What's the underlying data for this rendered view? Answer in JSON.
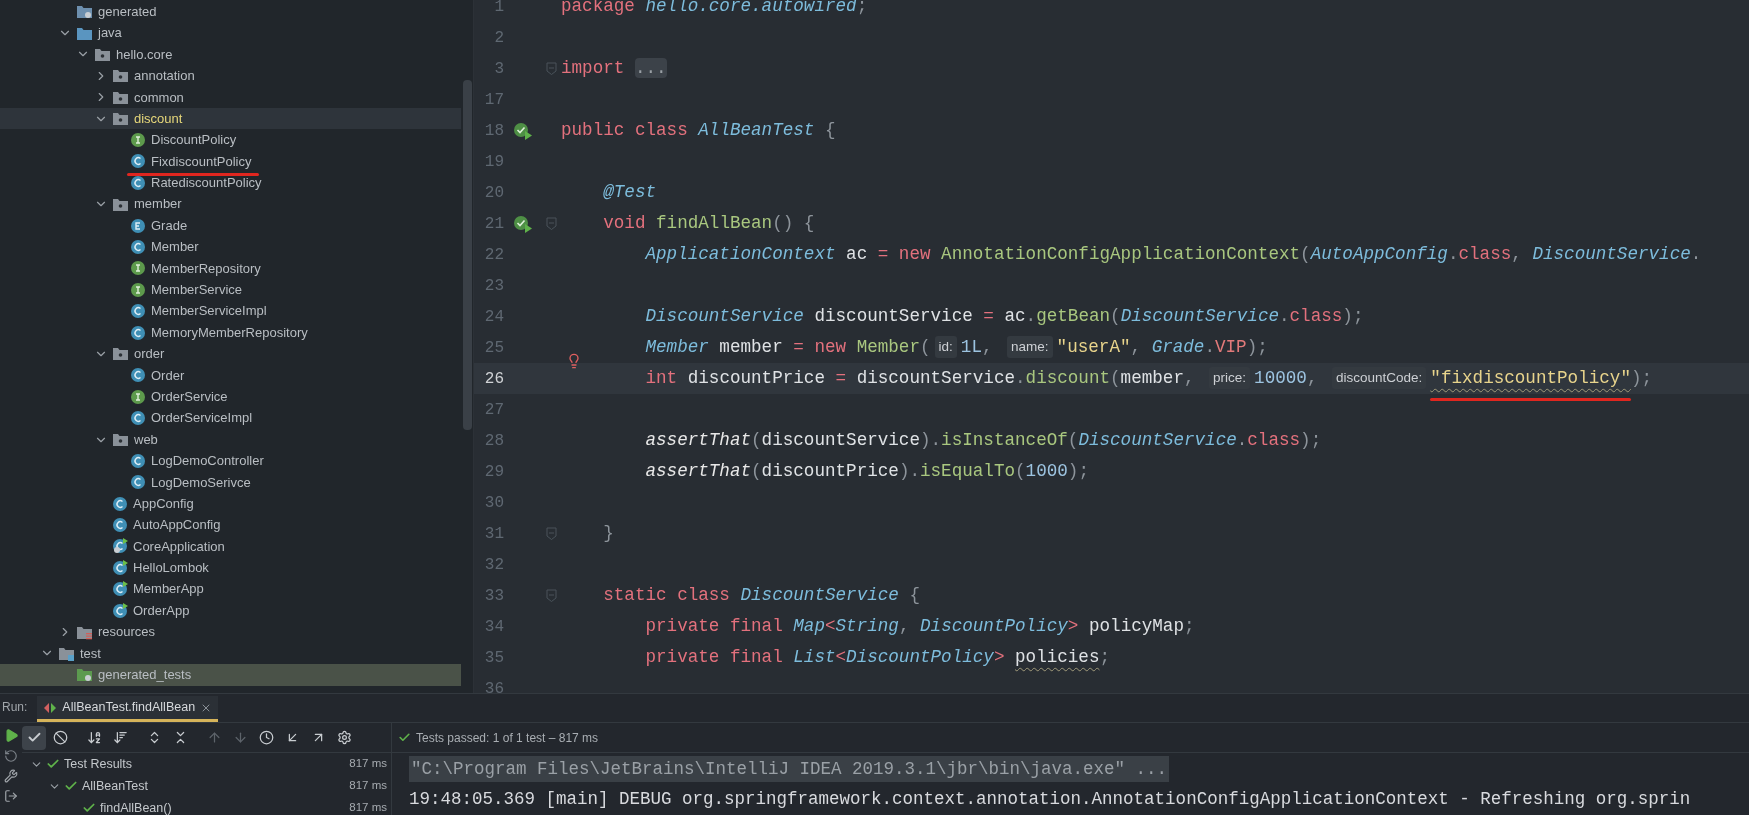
{
  "project_tree": [
    {
      "children": [
        {
          "label": "generated",
          "kind": "generated",
          "selected": false
        },
        {
          "label": "java",
          "kind": "source-root",
          "expanded": true,
          "selected": false,
          "children": [
            {
              "label": "hello.core",
              "kind": "package",
              "expanded": true,
              "selected": false,
              "children": [
                {
                  "label": "annotation",
                  "kind": "package",
                  "expanded": false,
                  "selected": false
                },
                {
                  "label": "common",
                  "kind": "package",
                  "expanded": false,
                  "selected": false
                },
                {
                  "label": "discount",
                  "kind": "package",
                  "expanded": true,
                  "selected": true,
                  "children": [
                    {
                      "label": "DiscountPolicy",
                      "kind": "interface",
                      "selected": false
                    },
                    {
                      "label": "FixdiscountPolicy",
                      "kind": "class",
                      "selected": false,
                      "marked": true
                    },
                    {
                      "label": "RatediscountPolicy",
                      "kind": "class",
                      "selected": false
                    }
                  ]
                },
                {
                  "label": "member",
                  "kind": "package",
                  "expanded": true,
                  "selected": false,
                  "children": [
                    {
                      "label": "Grade",
                      "kind": "enum",
                      "selected": false
                    },
                    {
                      "label": "Member",
                      "kind": "class",
                      "selected": false
                    },
                    {
                      "label": "MemberRepository",
                      "kind": "interface",
                      "selected": false
                    },
                    {
                      "label": "MemberService",
                      "kind": "interface",
                      "selected": false
                    },
                    {
                      "label": "MemberServiceImpl",
                      "kind": "class",
                      "selected": false
                    },
                    {
                      "label": "MemoryMemberRepository",
                      "kind": "class",
                      "selected": false
                    }
                  ]
                },
                {
                  "label": "order",
                  "kind": "package",
                  "expanded": true,
                  "selected": false,
                  "children": [
                    {
                      "label": "Order",
                      "kind": "class",
                      "selected": false
                    },
                    {
                      "label": "OrderService",
                      "kind": "interface",
                      "selected": false
                    },
                    {
                      "label": "OrderServiceImpl",
                      "kind": "class",
                      "selected": false
                    }
                  ]
                },
                {
                  "label": "web",
                  "kind": "package",
                  "expanded": true,
                  "selected": false,
                  "children": [
                    {
                      "label": "LogDemoController",
                      "kind": "class",
                      "selected": false
                    },
                    {
                      "label": "LogDemoSerivce",
                      "kind": "class",
                      "selected": false
                    }
                  ]
                },
                {
                  "label": "AppConfig",
                  "kind": "class",
                  "selected": false
                },
                {
                  "label": "AutoAppConfig",
                  "kind": "class",
                  "selected": false
                },
                {
                  "label": "CoreApplication",
                  "kind": "spring-main",
                  "selected": false
                },
                {
                  "label": "HelloLombok",
                  "kind": "main-class",
                  "selected": false
                },
                {
                  "label": "MemberApp",
                  "kind": "main-class",
                  "selected": false
                },
                {
                  "label": "OrderApp",
                  "kind": "main-class",
                  "selected": false
                }
              ]
            }
          ]
        },
        {
          "label": "resources",
          "kind": "resources",
          "expanded": false,
          "selected": false
        }
      ]
    },
    {
      "label": "test",
      "kind": "test-root",
      "expanded": true,
      "selected": false,
      "children": [
        {
          "label": "generated_tests",
          "kind": "generated-tests",
          "selected": false
        }
      ]
    }
  ],
  "editor": {
    "lines": [
      {
        "number": "1",
        "tokens": [
          {
            "kind": "keyword",
            "text": "package "
          },
          {
            "kind": "type",
            "text": "hello.core.autowired"
          },
          {
            "kind": "punct",
            "text": ";"
          }
        ]
      },
      {
        "number": "2"
      },
      {
        "number": "3",
        "fold": true,
        "tokens": [
          {
            "kind": "keyword",
            "text": "import "
          },
          {
            "kind": "fold",
            "text": "..."
          }
        ]
      },
      {
        "number": "17"
      },
      {
        "number": "18",
        "gutter": {
          "kind": "run"
        },
        "tokens": [
          {
            "kind": "keyword",
            "text": "public class "
          },
          {
            "kind": "type",
            "text": "AllBeanTest"
          },
          {
            "kind": "punct",
            "text": " {"
          }
        ]
      },
      {
        "number": "19"
      },
      {
        "number": "20",
        "tokens": [
          {
            "kind": "annotation",
            "text": "    @Test"
          }
        ]
      },
      {
        "number": "21",
        "gutter": {
          "kind": "run"
        },
        "fold": true,
        "tokens": [
          {
            "kind": "keyword",
            "text": "    void "
          },
          {
            "kind": "method",
            "text": "findAllBean"
          },
          {
            "kind": "punct",
            "text": "() {"
          }
        ]
      },
      {
        "number": "22",
        "tokens": [
          {
            "kind": "type",
            "text": "        ApplicationContext"
          },
          {
            "kind": "plain",
            "text": " ac "
          },
          {
            "kind": "keyword",
            "text": "= new "
          },
          {
            "kind": "method",
            "text": "AnnotationConfigApplicationContext"
          },
          {
            "kind": "punct",
            "text": "("
          },
          {
            "kind": "type",
            "text": "AutoAppConfig"
          },
          {
            "kind": "punct",
            "text": "."
          },
          {
            "kind": "keyword",
            "text": "class"
          },
          {
            "kind": "punct",
            "text": ", "
          },
          {
            "kind": "type",
            "text": "DiscountService"
          },
          {
            "kind": "punct",
            "text": "."
          }
        ]
      },
      {
        "number": "23"
      },
      {
        "number": "24",
        "tokens": [
          {
            "kind": "type",
            "text": "        DiscountService"
          },
          {
            "kind": "plain",
            "text": " discountService "
          },
          {
            "kind": "keyword",
            "text": "= "
          },
          {
            "kind": "plain",
            "text": "ac"
          },
          {
            "kind": "punct",
            "text": "."
          },
          {
            "kind": "method",
            "text": "getBean"
          },
          {
            "kind": "punct",
            "text": "("
          },
          {
            "kind": "type",
            "text": "DiscountService"
          },
          {
            "kind": "punct",
            "text": "."
          },
          {
            "kind": "keyword",
            "text": "class"
          },
          {
            "kind": "punct",
            "text": ");"
          }
        ]
      },
      {
        "number": "25",
        "tokens": [
          {
            "kind": "type",
            "text": "        Member"
          },
          {
            "kind": "plain",
            "text": " member "
          },
          {
            "kind": "keyword",
            "text": "= new "
          },
          {
            "kind": "method",
            "text": "Member"
          },
          {
            "kind": "punct",
            "text": "("
          },
          {
            "kind": "hint",
            "text": "id:"
          },
          {
            "kind": "number",
            "text": "1L"
          },
          {
            "kind": "punct",
            "text": ", "
          },
          {
            "kind": "hint",
            "text": "name:"
          },
          {
            "kind": "string",
            "text": "\"userA\""
          },
          {
            "kind": "punct",
            "text": ", "
          },
          {
            "kind": "type",
            "text": "Grade"
          },
          {
            "kind": "punct",
            "text": "."
          },
          {
            "kind": "constant",
            "text": "VIP"
          },
          {
            "kind": "punct",
            "text": ");"
          }
        ]
      },
      {
        "number": "26",
        "current": true,
        "gutter": {
          "kind": "bulb"
        },
        "tokens": [
          {
            "kind": "keyword",
            "text": "        int "
          },
          {
            "kind": "plain",
            "text": "discountPrice "
          },
          {
            "kind": "keyword",
            "text": "= "
          },
          {
            "kind": "plain",
            "text": "discountService"
          },
          {
            "kind": "punct",
            "text": "."
          },
          {
            "kind": "method",
            "text": "discount"
          },
          {
            "kind": "punct",
            "text": "("
          },
          {
            "kind": "plain",
            "text": "member"
          },
          {
            "kind": "punct",
            "text": ", "
          },
          {
            "kind": "hint",
            "text": "price:"
          },
          {
            "kind": "number",
            "text": "10000"
          },
          {
            "kind": "punct",
            "text": ", "
          },
          {
            "kind": "hint",
            "text": "discountCode:"
          },
          {
            "kind": "string",
            "text": "\"fixdiscountPolicy\"",
            "marked": true,
            "squiggle": true
          },
          {
            "kind": "punct",
            "text": ");"
          }
        ]
      },
      {
        "number": "27"
      },
      {
        "number": "28",
        "tokens": [
          {
            "kind": "static",
            "text": "        assertThat"
          },
          {
            "kind": "punct",
            "text": "("
          },
          {
            "kind": "plain",
            "text": "discountService"
          },
          {
            "kind": "punct",
            "text": ")."
          },
          {
            "kind": "method",
            "text": "isInstanceOf"
          },
          {
            "kind": "punct",
            "text": "("
          },
          {
            "kind": "type",
            "text": "DiscountService"
          },
          {
            "kind": "punct",
            "text": "."
          },
          {
            "kind": "keyword",
            "text": "class"
          },
          {
            "kind": "punct",
            "text": ");"
          }
        ]
      },
      {
        "number": "29",
        "tokens": [
          {
            "kind": "static",
            "text": "        assertThat"
          },
          {
            "kind": "punct",
            "text": "("
          },
          {
            "kind": "plain",
            "text": "discountPrice"
          },
          {
            "kind": "punct",
            "text": ")."
          },
          {
            "kind": "method",
            "text": "isEqualTo"
          },
          {
            "kind": "punct",
            "text": "("
          },
          {
            "kind": "number",
            "text": "1000"
          },
          {
            "kind": "punct",
            "text": ");"
          }
        ]
      },
      {
        "number": "30"
      },
      {
        "number": "31",
        "fold": true,
        "tokens": [
          {
            "kind": "punct",
            "text": "    }"
          }
        ]
      },
      {
        "number": "32"
      },
      {
        "number": "33",
        "fold": true,
        "tokens": [
          {
            "kind": "keyword",
            "text": "    static class "
          },
          {
            "kind": "type",
            "text": "DiscountService"
          },
          {
            "kind": "punct",
            "text": " {"
          }
        ]
      },
      {
        "number": "34",
        "tokens": [
          {
            "kind": "keyword",
            "text": "        private final "
          },
          {
            "kind": "type",
            "text": "Map"
          },
          {
            "kind": "keyword",
            "text": "<"
          },
          {
            "kind": "type",
            "text": "String"
          },
          {
            "kind": "punct",
            "text": ", "
          },
          {
            "kind": "type",
            "text": "DiscountPolicy"
          },
          {
            "kind": "keyword",
            "text": "> "
          },
          {
            "kind": "plain",
            "text": "policyMap"
          },
          {
            "kind": "punct",
            "text": ";"
          }
        ]
      },
      {
        "number": "35",
        "tokens": [
          {
            "kind": "keyword",
            "text": "        private final "
          },
          {
            "kind": "type",
            "text": "List"
          },
          {
            "kind": "keyword",
            "text": "<"
          },
          {
            "kind": "type",
            "text": "DiscountPolicy"
          },
          {
            "kind": "keyword",
            "text": "> "
          },
          {
            "kind": "plain",
            "text": "policies",
            "squiggle": true
          },
          {
            "kind": "punct",
            "text": ";"
          }
        ]
      },
      {
        "number": "36"
      }
    ]
  },
  "run": {
    "label": "Run:",
    "tabs": [
      {
        "label": "AllBeanTest.findAllBean",
        "selected": true
      }
    ],
    "show_passed": true,
    "status": "Tests passed: 1 of 1 test – 817 ms",
    "results": [
      {
        "label": "Test Results",
        "time": "817 ms",
        "passed": true,
        "expanded": true,
        "children": [
          {
            "label": "AllBeanTest",
            "time": "817 ms",
            "passed": true,
            "expanded": true,
            "children": [
              {
                "label": "findAllBean()",
                "time": "817 ms",
                "passed": true
              }
            ]
          }
        ]
      }
    ],
    "console": [
      {
        "kind": "command",
        "text": "\"C:\\Program Files\\JetBrains\\IntelliJ IDEA 2019.3.1\\jbr\\bin\\java.exe\" ..."
      },
      {
        "kind": "log",
        "text": "19:48:05.369 [main] DEBUG org.springframework.context.annotation.AnnotationConfigApplicationContext - Refreshing org.sprin"
      }
    ]
  }
}
